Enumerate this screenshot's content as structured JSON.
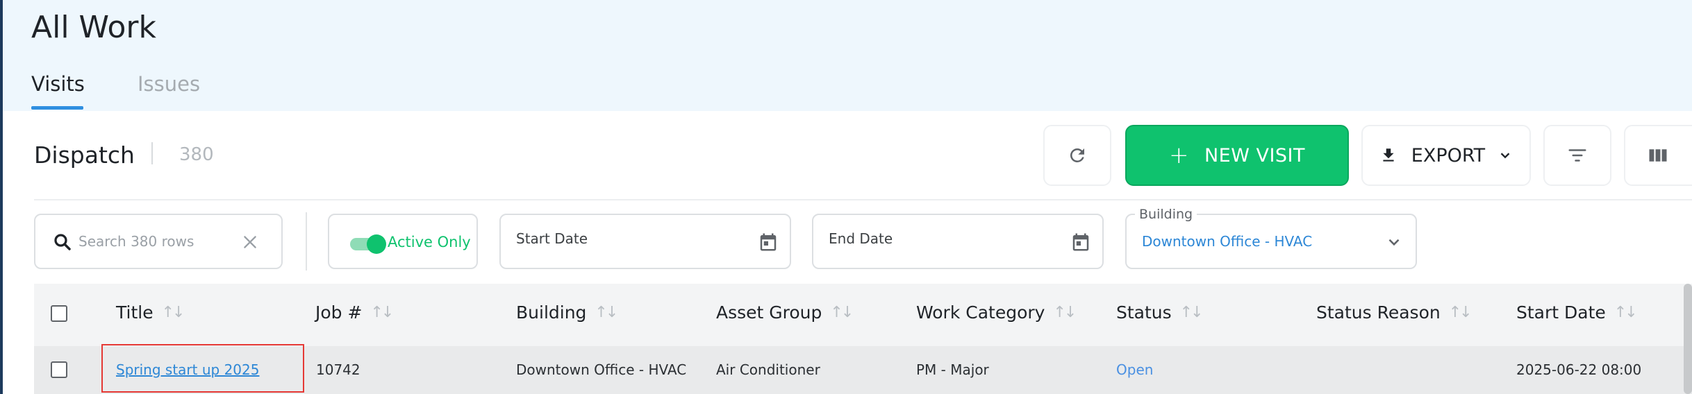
{
  "page": {
    "title": "All Work"
  },
  "tabs": [
    {
      "label": "Visits",
      "active": true
    },
    {
      "label": "Issues",
      "active": false
    }
  ],
  "toolbar": {
    "title": "Dispatch",
    "count": "380",
    "new_visit_label": "NEW VISIT",
    "export_label": "EXPORT",
    "icons": {
      "refresh": "refresh-icon",
      "plus": "plus-icon",
      "download": "download-icon",
      "filter": "filter-icon",
      "columns": "columns-icon"
    }
  },
  "filters": {
    "search_placeholder": "Search 380 rows",
    "active_only_label": "Active Only",
    "active_only_on": true,
    "start_date_label": "Start Date",
    "end_date_label": "End Date",
    "building_label": "Building",
    "building_value": "Downtown Office - HVAC"
  },
  "table": {
    "columns": [
      "Title",
      "Job #",
      "Building",
      "Asset Group",
      "Work Category",
      "Status",
      "Status Reason",
      "Start Date"
    ],
    "rows": [
      {
        "title": "Spring start up 2025",
        "job": "10742",
        "building": "Downtown Office - HVAC",
        "asset_group": "Air Conditioner",
        "work_category": "PM - Major",
        "status": "Open",
        "status_reason": "",
        "start_date": "2025-06-22 08:00"
      }
    ]
  },
  "colors": {
    "accent_green": "#0fc26e",
    "link_blue": "#2d87d6",
    "tab_underline": "#2f8fe0",
    "highlight_red": "#e53935",
    "header_bg": "#eef7fd"
  }
}
